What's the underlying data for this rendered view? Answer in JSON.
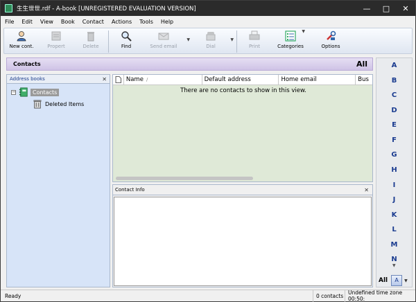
{
  "window": {
    "title": "生生世世.rdf - A-book [UNREGISTERED EVALUATION VERSION]",
    "minimize_glyph": "—",
    "restore_glyph": "□",
    "close_glyph": "✕"
  },
  "menu": [
    "File",
    "Edit",
    "View",
    "Book",
    "Contact",
    "Actions",
    "Tools",
    "Help"
  ],
  "toolbar": {
    "new_contact": "New cont.",
    "properties": "Propert",
    "delete": "Delete",
    "find": "Find",
    "send_email": "Send email",
    "dial": "Dial",
    "print": "Print",
    "categories": "Categories",
    "options": "Options"
  },
  "contacts_bar": {
    "title": "Contacts",
    "filter": "All"
  },
  "address_books": {
    "header": "Address books",
    "close_glyph": "✕",
    "items": [
      {
        "label": "Contacts",
        "icon": "address-book-icon"
      },
      {
        "label": "Deleted Items",
        "icon": "trash-icon"
      }
    ]
  },
  "contact_list": {
    "columns": [
      "Name",
      "Default address",
      "Home email",
      "Bus"
    ],
    "sort_indicator": "/",
    "empty_message": "There are no contacts to show in this view."
  },
  "contact_info": {
    "header": "Contact Info",
    "close_glyph": "✕"
  },
  "alphabet": {
    "letters": [
      "A",
      "B",
      "C",
      "D",
      "E",
      "F",
      "G",
      "H",
      "I",
      "J",
      "K",
      "L",
      "M",
      "N"
    ],
    "all": "All"
  },
  "status": {
    "state": "Ready",
    "count": "0 contacts",
    "timezone": "Undefined time zone 00:50:"
  },
  "colors": {
    "accent": "#1a3b8f",
    "list_background": "#dfe9d7",
    "tree_background": "#d7e4f8",
    "header_bar": "#cfc3e6"
  }
}
